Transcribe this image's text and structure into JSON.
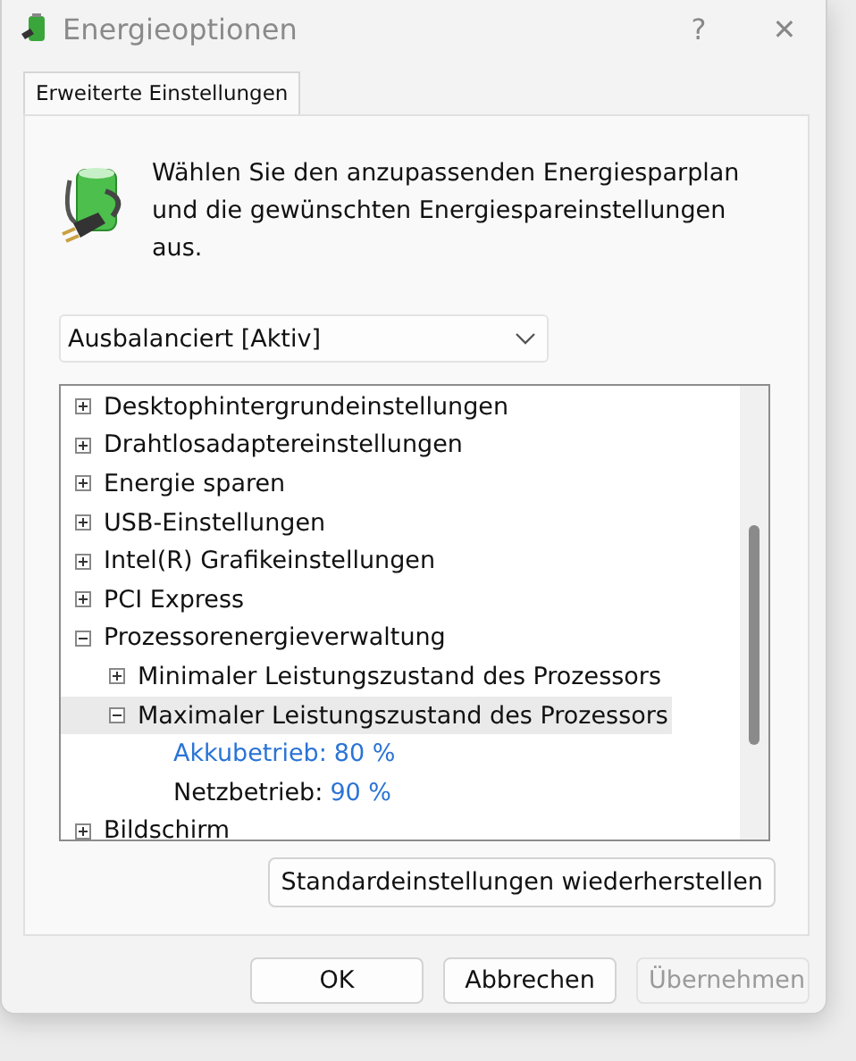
{
  "window": {
    "title": "Energieoptionen",
    "help": "?",
    "close": "✕"
  },
  "tabs": [
    {
      "label": "Erweiterte Einstellungen",
      "selected": true
    }
  ],
  "intro": "Wählen Sie den anzupassenden Energiesparplan und die gewünschten Energiespareinstellungen aus.",
  "plan_dropdown": {
    "value": "Ausbalanciert [Aktiv]"
  },
  "tree": [
    {
      "label": "Desktophintergrundeinstellungen",
      "expanded": false,
      "selected": false
    },
    {
      "label": "Drahtlosadaptereinstellungen",
      "expanded": false,
      "selected": false
    },
    {
      "label": "Energie sparen",
      "expanded": false,
      "selected": false
    },
    {
      "label": "USB-Einstellungen",
      "expanded": false,
      "selected": false
    },
    {
      "label": "Intel(R) Grafikeinstellungen",
      "expanded": false,
      "selected": false
    },
    {
      "label": "PCI Express",
      "expanded": false,
      "selected": false
    },
    {
      "label": "Prozessorenergieverwaltung",
      "expanded": true,
      "selected": false,
      "children": [
        {
          "label": "Minimaler Leistungszustand des Prozessors",
          "expanded": false,
          "selected": false
        },
        {
          "label": "Maximaler Leistungszustand des Prozessors",
          "expanded": true,
          "selected": true,
          "settings": [
            {
              "label": "Akkubetrieb:",
              "value": "80 %",
              "focused": true
            },
            {
              "label": "Netzbetrieb:",
              "value": "90 %",
              "focused": false
            }
          ]
        }
      ]
    },
    {
      "label": "Bildschirm",
      "expanded": false,
      "selected": false
    }
  ],
  "restore_button": "Standardeinstellungen wiederherstellen",
  "buttons": [
    {
      "label": "OK",
      "disabled": false
    },
    {
      "label": "Abbrechen",
      "disabled": false
    },
    {
      "label": "Übernehmen",
      "disabled": true
    }
  ]
}
